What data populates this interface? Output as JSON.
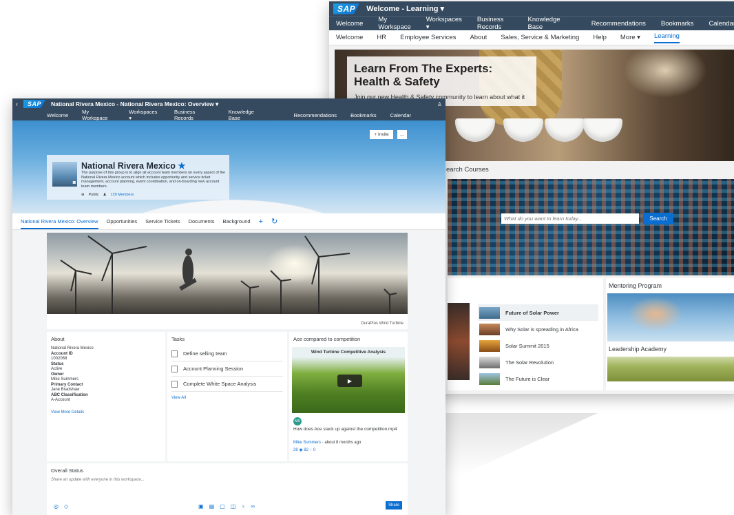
{
  "back": {
    "shell_title": "Welcome - Learning ▾",
    "logo": "SAP",
    "topnav": [
      "Welcome",
      "My Workspace",
      "Workspaces ▾",
      "Business Records",
      "Knowledge Base"
    ],
    "topnav_right": [
      "Recommendations",
      "Bookmarks",
      "Calendar"
    ],
    "subnav": [
      "Welcome",
      "HR",
      "Employee Services",
      "About",
      "Sales, Service & Marketing",
      "Help",
      "More ▾",
      "Learning"
    ],
    "hero": {
      "title": "Learn From The Experts: Health & Safety",
      "subtitle": "Join our new Health & Safety community to learn about what it takes to"
    },
    "search_courses": "earch Courses",
    "search_placeholder": "What do you want to learn today...",
    "search_button": "Search",
    "videos": [
      "Future of Solar Power",
      "Why Solar is spreading in Africa",
      "Solar Summit 2015",
      "The Solar Revolution",
      "The Future is Clear"
    ],
    "mentoring": "Mentoring Program",
    "leadership": "Leadership Academy"
  },
  "front": {
    "logo": "SAP",
    "shell_title": "National Rivera Mexico - National Rivera Mexico: Overview ▾",
    "topnav": [
      "Welcome",
      "My Workspace",
      "Workspaces ▾",
      "Business Records",
      "Knowledge Base"
    ],
    "topnav_right": [
      "Recommendations",
      "Bookmarks",
      "Calendar"
    ],
    "invite": "+ Invite",
    "more": "...",
    "group": {
      "name": "National Rivera Mexico",
      "star": "★",
      "desc": "The purpose of this group is to align all account team members on every aspect of the National Rivera Mexico account which includes opportunity and service ticket management, account planning, event coordination, and on-boarding new account team members.",
      "visibility": "Public",
      "members": "129 Members"
    },
    "tabs": [
      "National Rivera Mexico: Overview",
      "Opportunities",
      "Service Tickets",
      "Documents",
      "Background"
    ],
    "hero_caption": "DuraPlus Wind Turbine",
    "about": {
      "title": "About",
      "company": "National Rivera Mexico",
      "account_id_label": "Account ID",
      "account_id": "1002068",
      "status_label": "Status",
      "status": "Active",
      "owner_label": "Owner",
      "owner": "Mike Summers",
      "contact_label": "Primary Contact",
      "contact": "Jane Bradshaw",
      "abc_label": "ABC Classification",
      "abc": "A-Account",
      "more_link": "View More Details"
    },
    "tasks": {
      "title": "Tasks",
      "items": [
        "Define selling team",
        "Account Planning Session",
        "Complete White Space Analysis"
      ],
      "view_all": "View All"
    },
    "compete": {
      "title": "Ace compared to competition",
      "video_title": "Wind Turbine Competitive Analysis",
      "avatar": "MS",
      "caption": "How does Ace stack up against the competition.mp4",
      "author": "Mike Summers",
      "time": "about 8 months ago",
      "stats": "29 ◉ 82 ◌ 0"
    },
    "status": {
      "title": "Overall Status",
      "placeholder": "Share an update with everyone in this workspace...",
      "share": "Share"
    }
  }
}
